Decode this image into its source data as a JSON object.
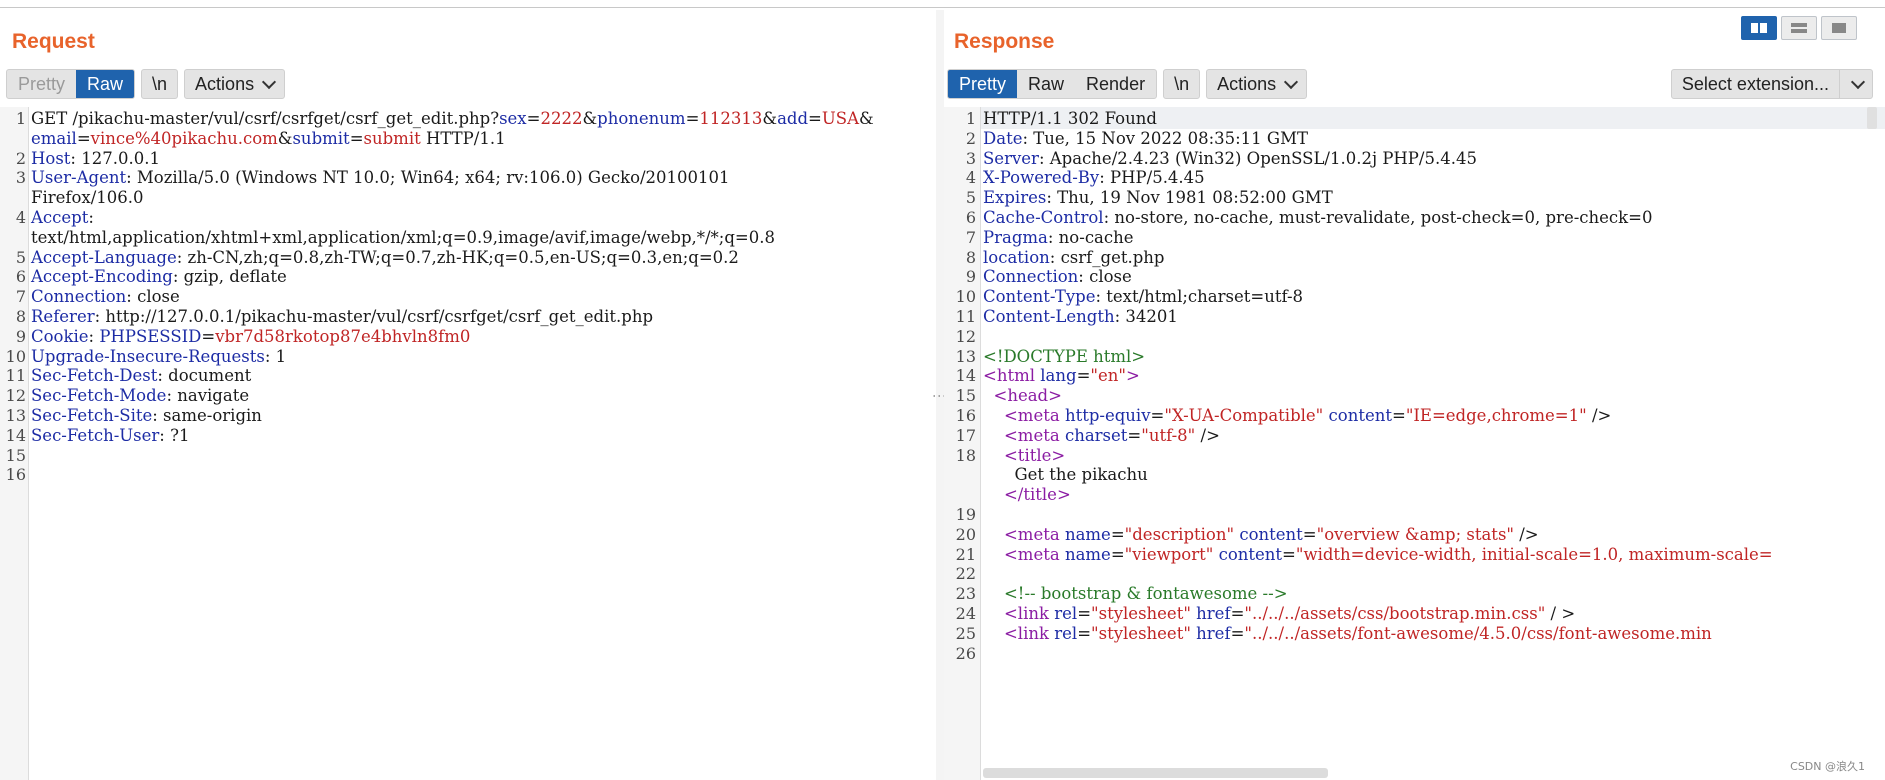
{
  "request": {
    "title": "Request",
    "tabs": [
      {
        "label": "Pretty"
      },
      {
        "label": "Raw"
      }
    ],
    "newline_toggle": "\\n",
    "actions_label": "Actions",
    "lines": [
      {
        "no": "1",
        "parts": [
          [
            "n",
            "GET /pikachu-master/vul/csrf/csrfget/csrf_get_edit.php?"
          ],
          [
            "k",
            "sex"
          ],
          [
            "n",
            "="
          ],
          [
            "v",
            "2222"
          ],
          [
            "n",
            "&"
          ],
          [
            "k",
            "phonenum"
          ],
          [
            "n",
            "="
          ],
          [
            "v",
            "112313"
          ],
          [
            "n",
            "&"
          ],
          [
            "k",
            "add"
          ],
          [
            "n",
            "="
          ],
          [
            "v",
            "USA"
          ],
          [
            "n",
            "&"
          ]
        ]
      },
      {
        "no": "",
        "parts": [
          [
            "k",
            "email"
          ],
          [
            "n",
            "="
          ],
          [
            "v",
            "vince%40pikachu.com"
          ],
          [
            "n",
            "&"
          ],
          [
            "k",
            "submit"
          ],
          [
            "n",
            "="
          ],
          [
            "v",
            "submit"
          ],
          [
            "n",
            " HTTP/1.1"
          ]
        ]
      },
      {
        "no": "2",
        "parts": [
          [
            "k",
            "Host"
          ],
          [
            "n",
            ": 127.0.0.1"
          ]
        ]
      },
      {
        "no": "3",
        "parts": [
          [
            "k",
            "User-Agent"
          ],
          [
            "n",
            ": Mozilla/5.0 (Windows NT 10.0; Win64; x64; rv:106.0) Gecko/20100101"
          ]
        ]
      },
      {
        "no": "",
        "parts": [
          [
            "n",
            "Firefox/106.0"
          ]
        ]
      },
      {
        "no": "4",
        "parts": [
          [
            "k",
            "Accept"
          ],
          [
            "n",
            ":"
          ]
        ]
      },
      {
        "no": "",
        "parts": [
          [
            "n",
            "text/html,application/xhtml+xml,application/xml;q=0.9,image/avif,image/webp,*/*;q=0.8"
          ]
        ]
      },
      {
        "no": "5",
        "parts": [
          [
            "k",
            "Accept-Language"
          ],
          [
            "n",
            ": zh-CN,zh;q=0.8,zh-TW;q=0.7,zh-HK;q=0.5,en-US;q=0.3,en;q=0.2"
          ]
        ]
      },
      {
        "no": "6",
        "parts": [
          [
            "k",
            "Accept-Encoding"
          ],
          [
            "n",
            ": gzip, deflate"
          ]
        ]
      },
      {
        "no": "7",
        "parts": [
          [
            "k",
            "Connection"
          ],
          [
            "n",
            ": close"
          ]
        ]
      },
      {
        "no": "8",
        "parts": [
          [
            "k",
            "Referer"
          ],
          [
            "n",
            ": http://127.0.0.1/pikachu-master/vul/csrf/csrfget/csrf_get_edit.php"
          ]
        ]
      },
      {
        "no": "9",
        "parts": [
          [
            "k",
            "Cookie"
          ],
          [
            "n",
            ": "
          ],
          [
            "k",
            "PHPSESSID"
          ],
          [
            "n",
            "="
          ],
          [
            "v",
            "vbr7d58rkotop87e4bhvln8fm0"
          ]
        ]
      },
      {
        "no": "10",
        "parts": [
          [
            "k",
            "Upgrade-Insecure-Requests"
          ],
          [
            "n",
            ": 1"
          ]
        ]
      },
      {
        "no": "11",
        "parts": [
          [
            "k",
            "Sec-Fetch-Dest"
          ],
          [
            "n",
            ": document"
          ]
        ]
      },
      {
        "no": "12",
        "parts": [
          [
            "k",
            "Sec-Fetch-Mode"
          ],
          [
            "n",
            ": navigate"
          ]
        ]
      },
      {
        "no": "13",
        "parts": [
          [
            "k",
            "Sec-Fetch-Site"
          ],
          [
            "n",
            ": same-origin"
          ]
        ]
      },
      {
        "no": "14",
        "parts": [
          [
            "k",
            "Sec-Fetch-User"
          ],
          [
            "n",
            ": ?1"
          ]
        ]
      },
      {
        "no": "15",
        "parts": []
      },
      {
        "no": "16",
        "parts": []
      }
    ]
  },
  "response": {
    "title": "Response",
    "tabs": [
      {
        "label": "Pretty"
      },
      {
        "label": "Raw"
      },
      {
        "label": "Render"
      }
    ],
    "newline_toggle": "\\n",
    "actions_label": "Actions",
    "select_extension_label": "Select extension...",
    "lines": [
      {
        "no": "1",
        "parts": [
          [
            "n",
            "HTTP/1.1 302 Found"
          ]
        ]
      },
      {
        "no": "2",
        "parts": [
          [
            "k",
            "Date"
          ],
          [
            "n",
            ": Tue, 15 Nov 2022 08:35:11 GMT"
          ]
        ]
      },
      {
        "no": "3",
        "parts": [
          [
            "k",
            "Server"
          ],
          [
            "n",
            ": Apache/2.4.23 (Win32) OpenSSL/1.0.2j PHP/5.4.45"
          ]
        ]
      },
      {
        "no": "4",
        "parts": [
          [
            "k",
            "X-Powered-By"
          ],
          [
            "n",
            ": PHP/5.4.45"
          ]
        ]
      },
      {
        "no": "5",
        "parts": [
          [
            "k",
            "Expires"
          ],
          [
            "n",
            ": Thu, 19 Nov 1981 08:52:00 GMT"
          ]
        ]
      },
      {
        "no": "6",
        "parts": [
          [
            "k",
            "Cache-Control"
          ],
          [
            "n",
            ": no-store, no-cache, must-revalidate, post-check=0, pre-check=0"
          ]
        ]
      },
      {
        "no": "7",
        "parts": [
          [
            "k",
            "Pragma"
          ],
          [
            "n",
            ": no-cache"
          ]
        ]
      },
      {
        "no": "8",
        "parts": [
          [
            "k",
            "location"
          ],
          [
            "n",
            ": csrf_get.php"
          ]
        ]
      },
      {
        "no": "9",
        "parts": [
          [
            "k",
            "Connection"
          ],
          [
            "n",
            ": close"
          ]
        ]
      },
      {
        "no": "10",
        "parts": [
          [
            "k",
            "Content-Type"
          ],
          [
            "n",
            ": text/html;charset=utf-8"
          ]
        ]
      },
      {
        "no": "11",
        "parts": [
          [
            "k",
            "Content-Length"
          ],
          [
            "n",
            ": 34201"
          ]
        ]
      },
      {
        "no": "12",
        "parts": []
      },
      {
        "no": "13",
        "parts": [
          [
            "c",
            "<!DOCTYPE html>"
          ]
        ]
      },
      {
        "no": "14",
        "parts": [
          [
            "t",
            "<html"
          ],
          [
            "a",
            " lang"
          ],
          [
            "n",
            "="
          ],
          [
            "s",
            "\"en\""
          ],
          [
            "t",
            ">"
          ]
        ]
      },
      {
        "no": "15",
        "parts": [
          [
            "n",
            "  "
          ],
          [
            "t",
            "<head>"
          ]
        ]
      },
      {
        "no": "16",
        "parts": [
          [
            "n",
            "    "
          ],
          [
            "t",
            "<meta"
          ],
          [
            "a",
            " http-equiv"
          ],
          [
            "n",
            "="
          ],
          [
            "s",
            "\"X-UA-Compatible\""
          ],
          [
            "a",
            " content"
          ],
          [
            "n",
            "="
          ],
          [
            "s",
            "\"IE=edge,chrome=1\""
          ],
          [
            "n",
            " />"
          ]
        ]
      },
      {
        "no": "17",
        "parts": [
          [
            "n",
            "    "
          ],
          [
            "t",
            "<meta"
          ],
          [
            "a",
            " charset"
          ],
          [
            "n",
            "="
          ],
          [
            "s",
            "\"utf-8\""
          ],
          [
            "n",
            " />"
          ]
        ]
      },
      {
        "no": "18",
        "parts": [
          [
            "n",
            "    "
          ],
          [
            "t",
            "<title>"
          ]
        ]
      },
      {
        "no": "",
        "parts": [
          [
            "n",
            "      Get the pikachu"
          ]
        ]
      },
      {
        "no": "",
        "parts": [
          [
            "n",
            "    "
          ],
          [
            "t",
            "</title>"
          ]
        ]
      },
      {
        "no": "19",
        "parts": []
      },
      {
        "no": "20",
        "parts": [
          [
            "n",
            "    "
          ],
          [
            "t",
            "<meta"
          ],
          [
            "a",
            " name"
          ],
          [
            "n",
            "="
          ],
          [
            "s",
            "\"description\""
          ],
          [
            "a",
            " content"
          ],
          [
            "n",
            "="
          ],
          [
            "s",
            "\"overview &amp; stats\""
          ],
          [
            "n",
            " />"
          ]
        ]
      },
      {
        "no": "21",
        "parts": [
          [
            "n",
            "    "
          ],
          [
            "t",
            "<meta"
          ],
          [
            "a",
            " name"
          ],
          [
            "n",
            "="
          ],
          [
            "s",
            "\"viewport\""
          ],
          [
            "a",
            " content"
          ],
          [
            "n",
            "="
          ],
          [
            "s",
            "\"width=device-width, initial-scale=1.0, maximum-scale="
          ]
        ]
      },
      {
        "no": "22",
        "parts": []
      },
      {
        "no": "23",
        "parts": [
          [
            "n",
            "    "
          ],
          [
            "c",
            "<!-- bootstrap & fontawesome -->"
          ]
        ]
      },
      {
        "no": "24",
        "parts": [
          [
            "n",
            "    "
          ],
          [
            "t",
            "<link"
          ],
          [
            "a",
            " rel"
          ],
          [
            "n",
            "="
          ],
          [
            "s",
            "\"stylesheet\""
          ],
          [
            "a",
            " href"
          ],
          [
            "n",
            "="
          ],
          [
            "s",
            "\"../../../assets/css/bootstrap.min.css\""
          ],
          [
            "n",
            " / >"
          ]
        ]
      },
      {
        "no": "25",
        "parts": [
          [
            "n",
            "    "
          ],
          [
            "t",
            "<link"
          ],
          [
            "a",
            " rel"
          ],
          [
            "n",
            "="
          ],
          [
            "s",
            "\"stylesheet\""
          ],
          [
            "a",
            " href"
          ],
          [
            "n",
            "="
          ],
          [
            "s",
            "\"../../../assets/font-awesome/4.5.0/css/font-awesome.min"
          ]
        ]
      },
      {
        "no": "26",
        "parts": []
      }
    ]
  },
  "watermark": "CSDN @浪久1",
  "colors": {
    "accent": "#1f63ad",
    "title": "#e8632b",
    "key": "#1d2ca5",
    "value": "#c02525",
    "tag": "#8b1ca3",
    "comment": "#2a7a2a"
  }
}
